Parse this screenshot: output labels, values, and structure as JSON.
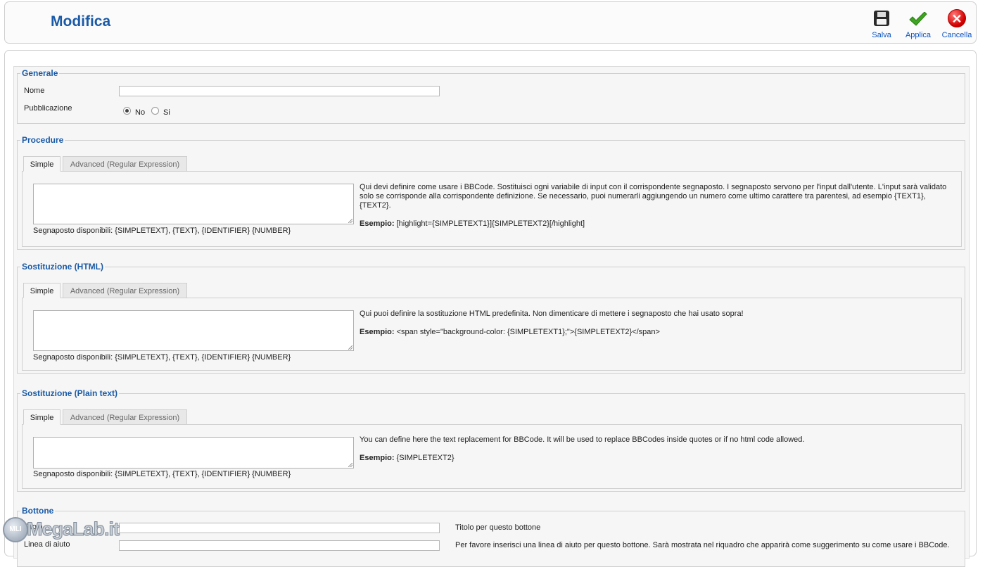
{
  "header": {
    "title": "Modifica",
    "toolbar": {
      "save_label": "Salva",
      "apply_label": "Applica",
      "cancel_label": "Cancella"
    }
  },
  "generale": {
    "legend": "Generale",
    "nome_label": "Nome",
    "nome_value": "",
    "pubblicazione_label": "Pubblicazione",
    "radio_no": "No",
    "radio_si": "Si",
    "selected": "No"
  },
  "procedure": {
    "legend": "Procedure",
    "tab_simple": "Simple",
    "tab_advanced": "Advanced (Regular Expression)",
    "placeholders": "Segnaposto disponibili: {SIMPLETEXT}, {TEXT}, {IDENTIFIER} {NUMBER}",
    "help_line1": "Qui devi definire come usare i BBCode. Sostituisci ogni variabile di input con il corrispondente segnaposto. I segnaposto servono per l'input dall'utente. L'input sarà validato",
    "help_line2": "solo se corrisponde alla corrispondente definizione. Se necessario, puoi numerarli aggiungendo un numero come ultimo carattere tra parentesi, ad esempio {TEXT1}, {TEXT2}.",
    "example_label": "Esempio:",
    "example_value": " [highlight={SIMPLETEXT1}]{SIMPLETEXT2}[/highlight]"
  },
  "sostituzione_html": {
    "legend": "Sostituzione (HTML)",
    "tab_simple": "Simple",
    "tab_advanced": "Advanced (Regular Expression)",
    "placeholders": "Segnaposto disponibili: {SIMPLETEXT}, {TEXT}, {IDENTIFIER} {NUMBER}",
    "help_line1": "Qui puoi definire la sostituzione HTML predefinita. Non dimenticare di mettere i segnaposto che hai usato sopra!",
    "example_label": "Esempio:",
    "example_value": " <span style=\"background-color: {SIMPLETEXT1};\">{SIMPLETEXT2}</span>"
  },
  "sostituzione_plain": {
    "legend": "Sostituzione (Plain text)",
    "tab_simple": "Simple",
    "tab_advanced": "Advanced (Regular Expression)",
    "placeholders": "Segnaposto disponibili: {SIMPLETEXT}, {TEXT}, {IDENTIFIER} {NUMBER}",
    "help_line1": "You can define here the text replacement for BBCode. It will be used to replace BBCodes inside quotes or if no html code allowed.",
    "example_label": "Esempio:",
    "example_value": " {SIMPLETEXT2}"
  },
  "bottone": {
    "legend": "Bottone",
    "titolo_label": "Titolo",
    "titolo_help": "Titolo per questo bottone",
    "linea_label": "Linea di aiuto",
    "linea_help": "Per favore inserisci una linea di aiuto per questo bottone. Sarà mostrata nel riquadro che apparirà come suggerimento su come usare i BBCode."
  },
  "watermark": {
    "badge": "MLI",
    "text": "MegaLab.it"
  }
}
